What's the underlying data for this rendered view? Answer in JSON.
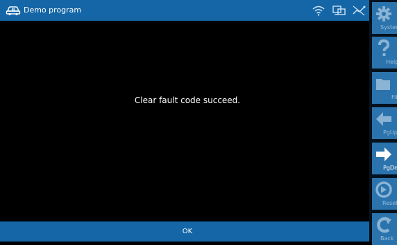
{
  "title_bar": {
    "title": "Demo program"
  },
  "main": {
    "message": "Clear fault code succeed."
  },
  "bottom_bar": {
    "ok_label": "OK"
  },
  "sidebar": {
    "items": [
      {
        "label": "System",
        "icon": "gear-icon"
      },
      {
        "label": "Help",
        "icon": "question-icon"
      },
      {
        "label": "File",
        "icon": "folder-icon"
      },
      {
        "label": "PgUp",
        "icon": "arrow-left-icon"
      },
      {
        "label": "PgDn",
        "icon": "arrow-right-icon"
      },
      {
        "label": "Reset",
        "icon": "reset-icon"
      },
      {
        "label": "Back",
        "icon": "back-icon"
      }
    ]
  },
  "colors": {
    "bar_blue": "#1466a6",
    "sidebar_button": "#2a73ad",
    "background": "#000000"
  }
}
